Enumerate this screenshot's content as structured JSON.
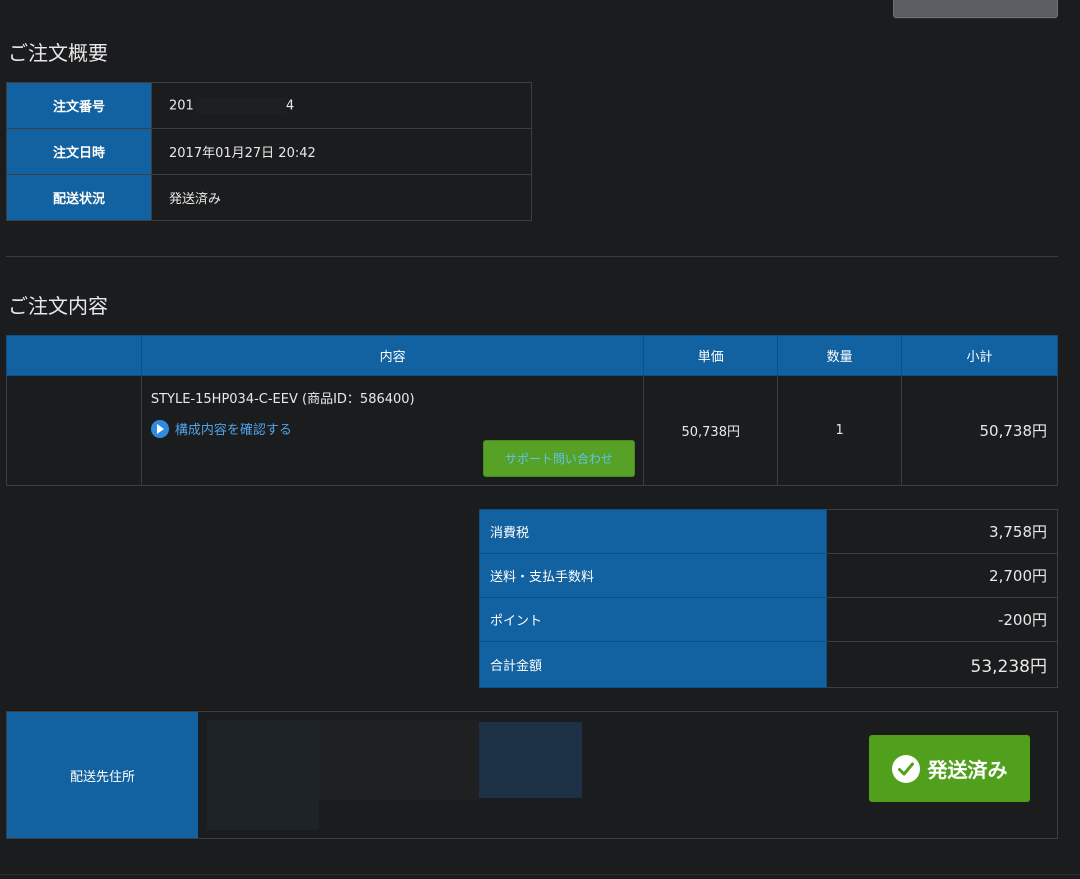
{
  "summary_section": {
    "title": "ご注文概要",
    "rows": [
      {
        "label": "注文番号",
        "value_prefix": "201",
        "value_suffix": "4"
      },
      {
        "label": "注文日時",
        "value": "2017年01月27日 20:42"
      },
      {
        "label": "配送状況",
        "value": "発送済み"
      }
    ]
  },
  "content_section": {
    "title": "ご注文内容",
    "headers": [
      "",
      "内容",
      "単価",
      "数量",
      "小計"
    ],
    "item": {
      "name": "STYLE-15HP034-C-EEV (商品ID：586400)",
      "link_label": "構成内容を確認する",
      "support_button_label": "サポート問い合わせ",
      "unit_price": "50,738円",
      "quantity": "1",
      "subtotal": "50,738円"
    }
  },
  "totals": [
    {
      "label": "消費税",
      "value": "3,758円"
    },
    {
      "label": "送料・支払手数料",
      "value": "2,700円"
    },
    {
      "label": "ポイント",
      "value": "-200円"
    },
    {
      "label": "合計金額",
      "value": "53,238円"
    }
  ],
  "address": {
    "label": "配送先住所",
    "status_badge": "発送済み"
  },
  "colors": {
    "background": "#1b1c1e",
    "header_blue": "#1261a0",
    "link_blue": "#4fa3e8",
    "success_green": "#50a01d"
  },
  "icons": {
    "play": "play-circle-icon",
    "check": "check-circle-icon"
  }
}
